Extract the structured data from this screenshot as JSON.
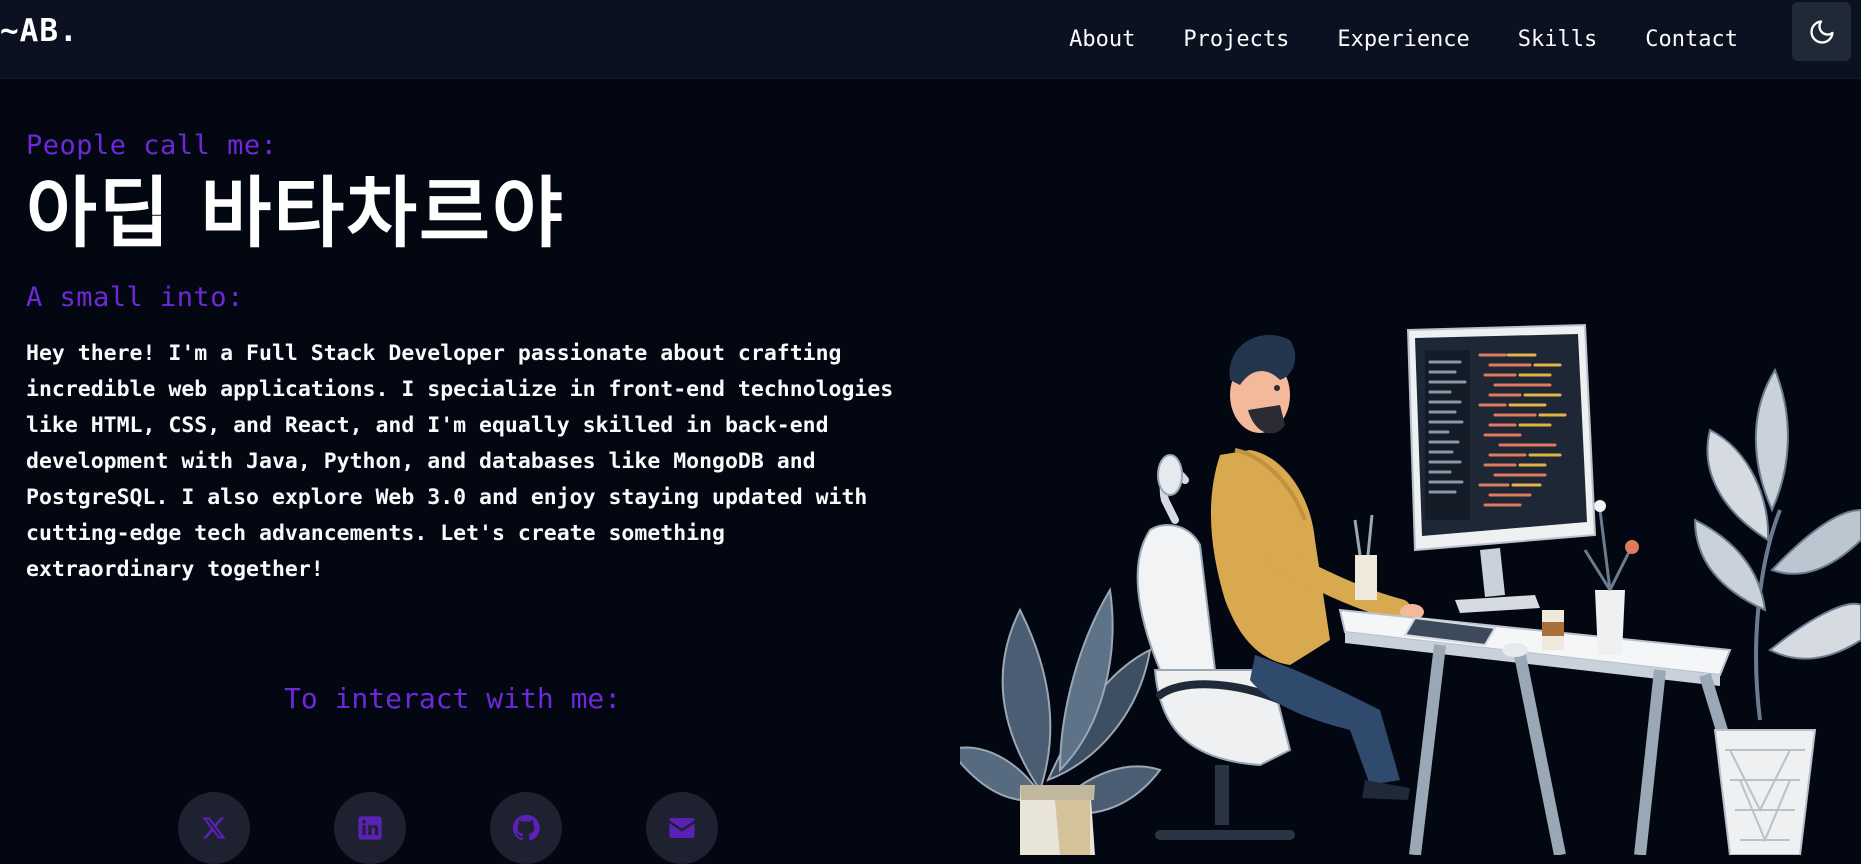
{
  "navbar": {
    "logo": "~AB.",
    "links": [
      {
        "label": "About"
      },
      {
        "label": "Projects"
      },
      {
        "label": "Experience"
      },
      {
        "label": "Skills"
      },
      {
        "label": "Contact"
      }
    ],
    "theme_toggle_icon": "moon-icon"
  },
  "hero": {
    "eyebrow": "People call me:",
    "name": "아딥 바타차르야",
    "intro_heading": "A small into:",
    "bio": "Hey there! I'm a Full Stack Developer passionate about crafting incredible web applications. I specialize in front-end technologies like HTML, CSS, and React, and I'm equally skilled in back-end development with Java, Python, and databases like MongoDB and PostgreSQL. I also explore Web 3.0 and enjoy staying updated with cutting-edge tech advancements. Let's create something extraordinary together!",
    "interact_heading": "To interact with me:",
    "socials": [
      {
        "icon": "x-twitter-icon"
      },
      {
        "icon": "linkedin-icon"
      },
      {
        "icon": "github-icon"
      },
      {
        "icon": "envelope-icon"
      }
    ]
  },
  "colors": {
    "background": "#030712",
    "navbar": "#0b1120",
    "accent": "#6d28d9",
    "social_bg": "#1e2230",
    "text": "#f9fafb"
  }
}
